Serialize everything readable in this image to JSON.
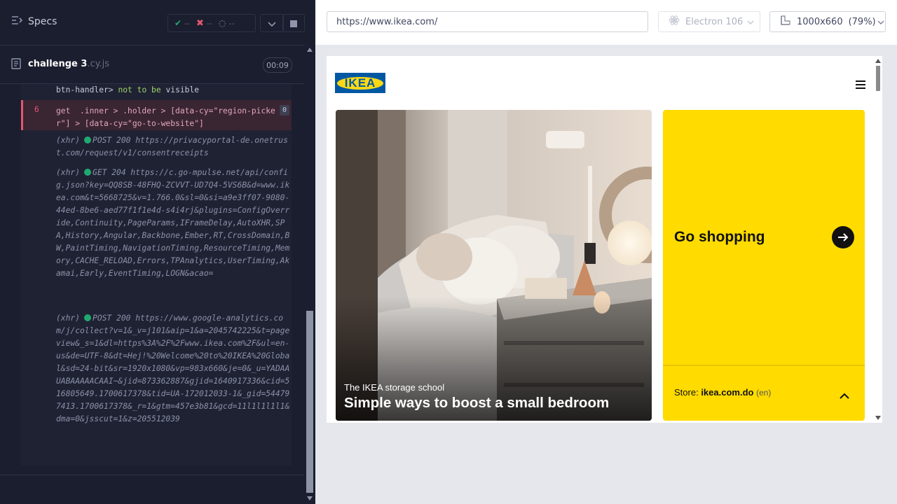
{
  "reporter": {
    "specs_label": "Specs",
    "stats": {
      "passed": "--",
      "failed": "--",
      "pending": "--"
    },
    "spec": {
      "name": "challenge 3",
      "ext": ".cy.js",
      "duration": "00:09"
    },
    "prev_line": {
      "selector": "btn-handler>",
      "assert_not": "not to be",
      "assert_value": "visible"
    },
    "command": {
      "number": "6",
      "text": "get  .inner > .holder > [data-cy=\"region-picker\"] > [data-cy=\"go-to-website\"]",
      "count": "0"
    },
    "xhr_entries": [
      {
        "type": "(xhr)",
        "text": "POST 200 https://privacyportal-de.onetrust.com/request/v1/consentreceipts"
      },
      {
        "type": "(xhr)",
        "text": "GET 204 https://c.go-mpulse.net/api/config.json?key=QQ8SB-48FHQ-ZCVVT-UD7Q4-5VS6B&d=www.ikea.com&t=5668725&v=1.766.0&sl=0&si=a9e3ff07-9080-44ed-8be6-aed77f1f1e4d-s4i4rj&plugins=ConfigOverride,Continuity,PageParams,IFrameDelay,AutoXHR,SPA,History,Angular,Backbone,Ember,RT,CrossDomain,BW,PaintTiming,NavigationTiming,ResourceTiming,Memory,CACHE_RELOAD,Errors,TPAnalytics,UserTiming,Akamai,Early,EventTiming,LOGN&acao="
      },
      {
        "type": "(xhr)",
        "text": "POST 200 https://www.google-analytics.com/j/collect?v=1&_v=j101&aip=1&a=2045742225&t=pageview&_s=1&dl=https%3A%2F%2Fwww.ikea.com%2F&ul=en-us&de=UTF-8&dt=Hej!%20Welcome%20to%20IKEA%20Global&sd=24-bit&sr=1920x1080&vp=983x660&je=0&_u=YADAAUABAAAAACAAI~&jid=873362887&gjid=1640917336&cid=516805649.1700617378&tid=UA-172012033-1&_gid=544797413.1700617378&_r=1&gtm=457e3b81&gcd=11l1l1l1l1&dma=0&jsscut=1&z=205512039"
      }
    ]
  },
  "aut": {
    "url": "https://www.ikea.com/",
    "browser": "Electron 106",
    "viewport": "1000x660",
    "zoom": "(79%)"
  },
  "site": {
    "logo": "IKEA",
    "hero_subtitle": "The IKEA storage school",
    "hero_title": "Simple ways to boost a small bedroom",
    "cta": "Go shopping",
    "store_label": "Store:",
    "store_domain": "ikea.com.do",
    "store_lang": "(en)"
  },
  "colors": {
    "ikea_blue": "#0058a3",
    "ikea_yellow": "#ffdb00",
    "pass_green": "#1fa971",
    "fail_red": "#e45770"
  }
}
